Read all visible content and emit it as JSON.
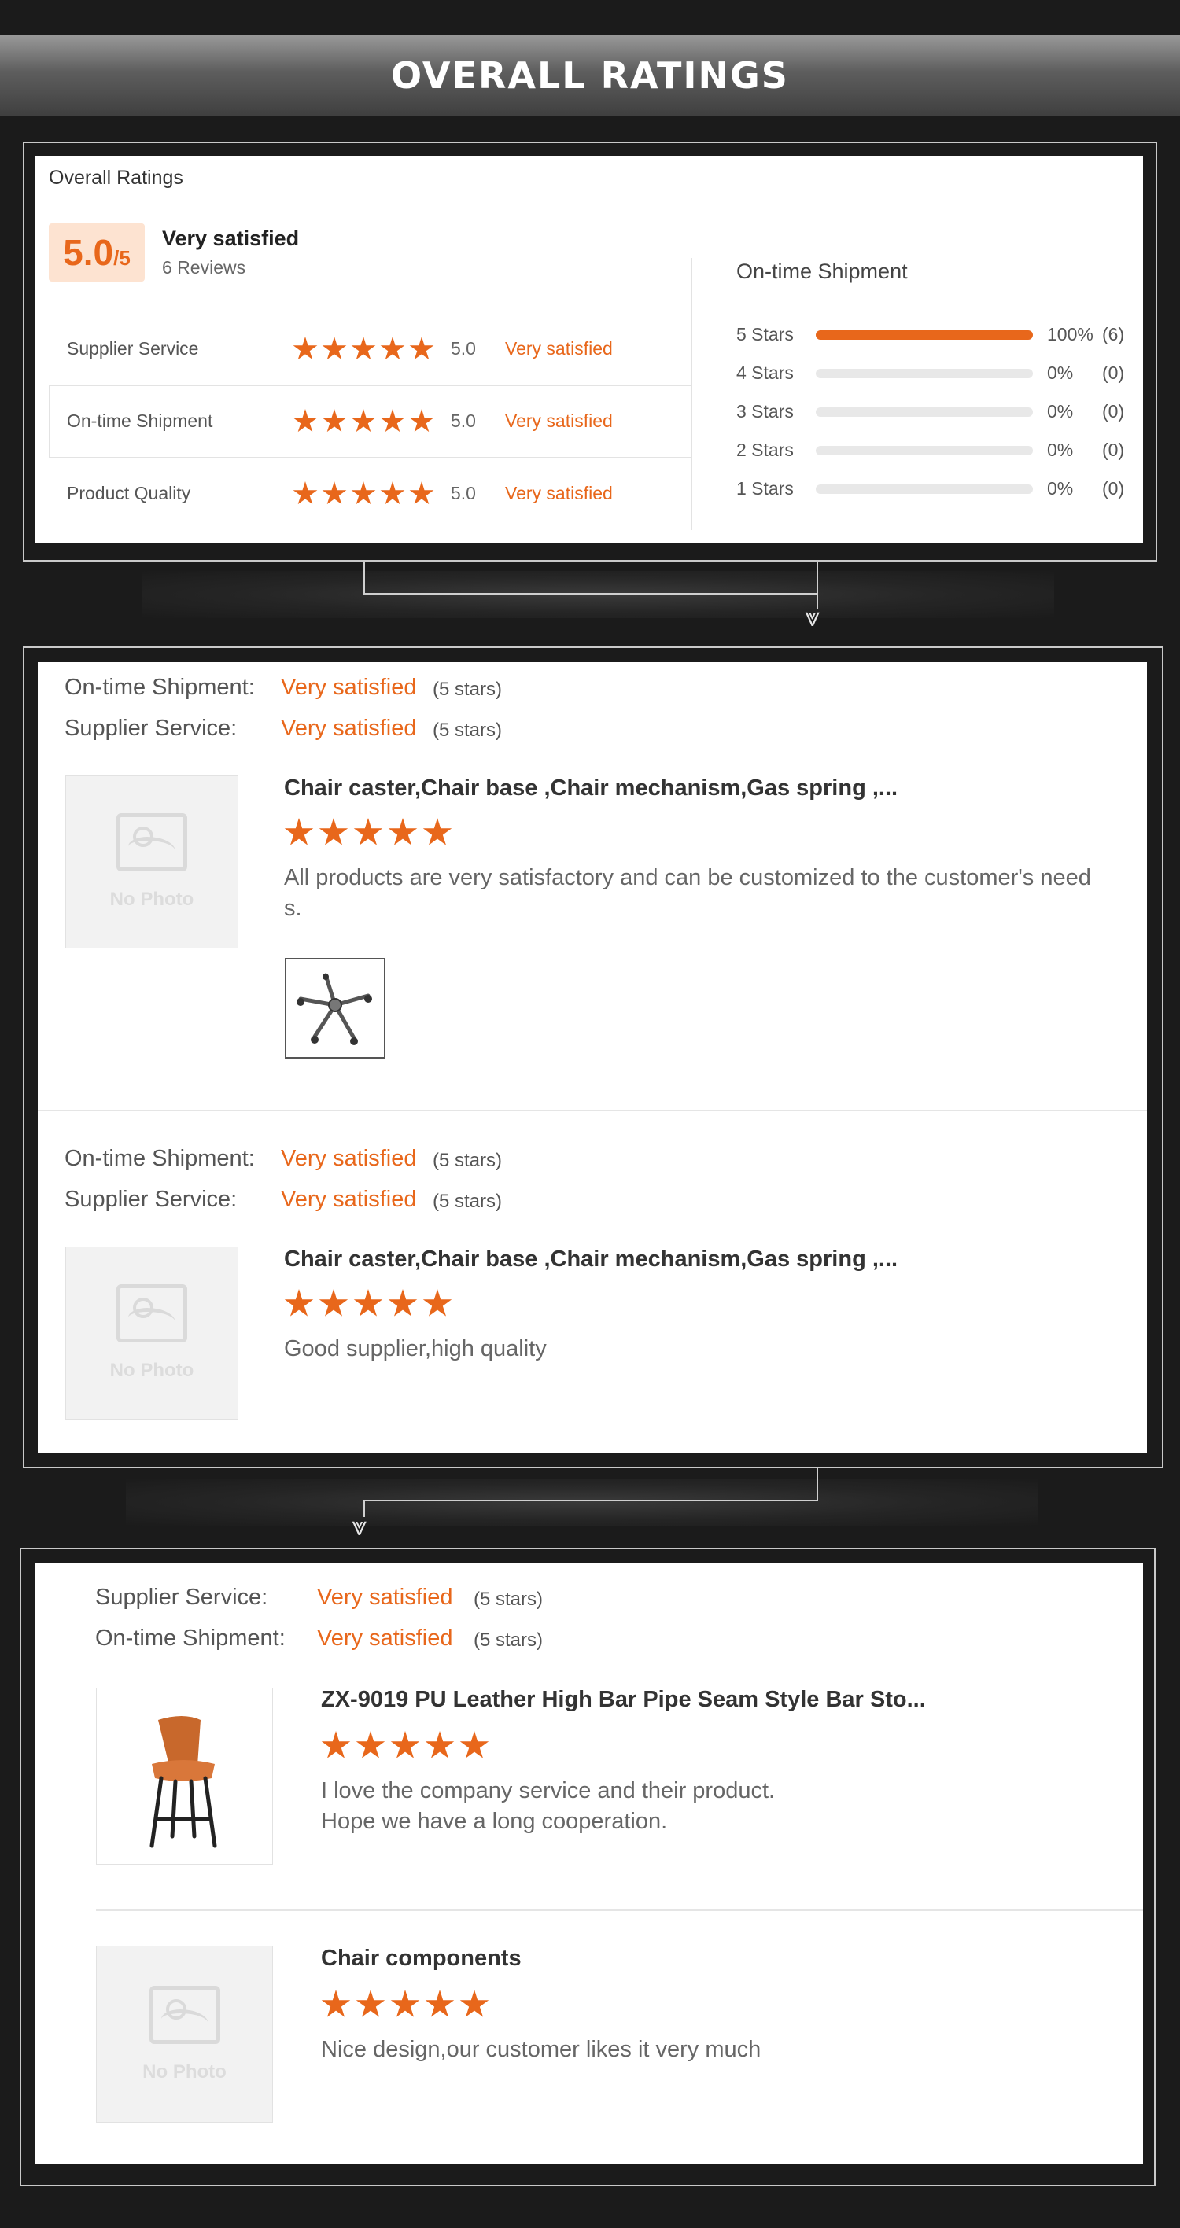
{
  "header": {
    "title": "OVERALL RATINGS"
  },
  "overall": {
    "heading": "Overall Ratings",
    "score": "5.0",
    "score_suffix": "/5",
    "summary": "Very satisfied",
    "reviews_count": "6 Reviews",
    "categories": [
      {
        "label": "Supplier Service",
        "stars": 5,
        "value": "5.0",
        "sentiment": "Very satisfied"
      },
      {
        "label": "On-time Shipment",
        "stars": 5,
        "value": "5.0",
        "sentiment": "Very satisfied"
      },
      {
        "label": "Product Quality",
        "stars": 5,
        "value": "5.0",
        "sentiment": "Very satisfied"
      }
    ],
    "breakdown_title": "On-time Shipment",
    "breakdown": [
      {
        "label": "5 Stars",
        "fraction": 1.0,
        "percent": "100%",
        "count": "(6)"
      },
      {
        "label": "4 Stars",
        "fraction": 0.0,
        "percent": "0%",
        "count": "(0)"
      },
      {
        "label": "3 Stars",
        "fraction": 0.0,
        "percent": "0%",
        "count": "(0)"
      },
      {
        "label": "2 Stars",
        "fraction": 0.0,
        "percent": "0%",
        "count": "(0)"
      },
      {
        "label": "1 Stars",
        "fraction": 0.0,
        "percent": "0%",
        "count": "(0)"
      }
    ]
  },
  "reviews": [
    {
      "line1_label": "On-time Shipment:",
      "line1_value": "Very satisfied",
      "line1_stars": "(5 stars)",
      "line2_label": "Supplier Service:",
      "line2_value": "Very satisfied",
      "line2_stars": "(5 stars)",
      "image_text": "No Photo",
      "product": "Chair caster,Chair base ,Chair mechanism,Gas spring ,...",
      "rating": 5,
      "comment_1": "All products are very satisfactory and can be customized to the customer's need",
      "comment_2": "s."
    },
    {
      "line1_label": "On-time Shipment:",
      "line1_value": "Very satisfied",
      "line1_stars": "(5 stars)",
      "line2_label": "Supplier Service:",
      "line2_value": "Very satisfied",
      "line2_stars": "(5 stars)",
      "image_text": "No Photo",
      "product": "Chair caster,Chair base ,Chair mechanism,Gas spring ,...",
      "rating": 5,
      "comment_1": "Good supplier,high quality"
    },
    {
      "line1_label": "Supplier Service:",
      "line1_value": "Very satisfied",
      "line1_stars": "(5 stars)",
      "line2_label": "On-time Shipment:",
      "line2_value": "Very satisfied",
      "line2_stars": "(5 stars)",
      "product": "ZX-9019 PU Leather High Bar Pipe Seam Style Bar Sto...",
      "rating": 5,
      "comment_1": "I love the company service and their product.",
      "comment_2": "Hope we have a long cooperation."
    },
    {
      "image_text": "No Photo",
      "product": "Chair components",
      "rating": 5,
      "comment_1": "Nice design,our customer likes it very much"
    }
  ],
  "colors": {
    "accent": "#e8671b",
    "accent_light": "#fde3d1",
    "background": "#1b1b1b"
  }
}
